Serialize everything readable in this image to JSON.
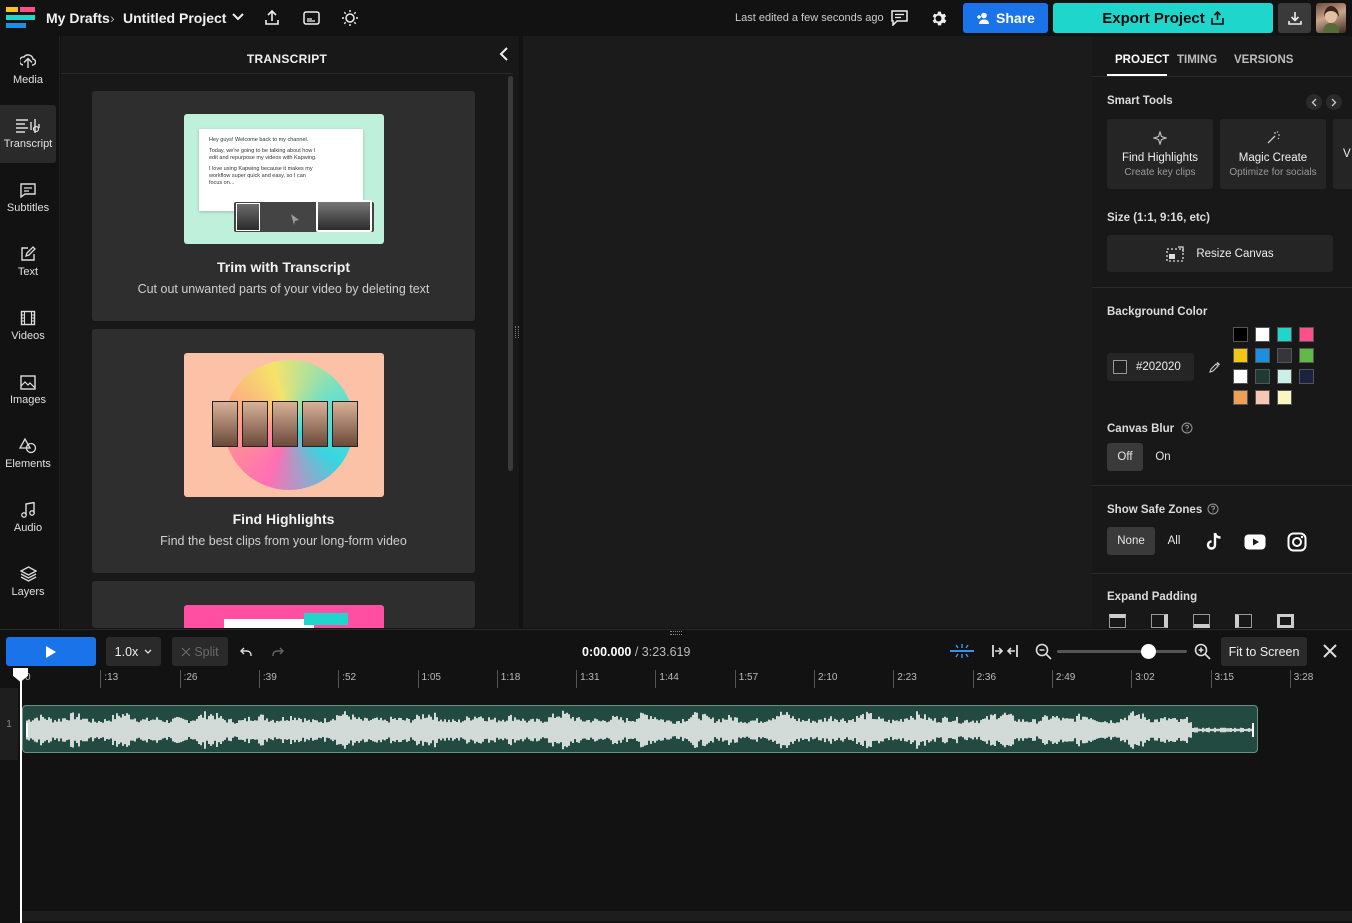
{
  "topbar": {
    "breadcrumb_root": "My Drafts",
    "project_title": "Untitled Project",
    "last_edited": "Last edited a few seconds ago",
    "share_label": "Share",
    "export_label": "Export Project",
    "colors": {
      "share": "#1a73e8",
      "export": "#1ed6cb"
    }
  },
  "sidebar": {
    "items": [
      {
        "label": "Media",
        "icon": "upload-icon"
      },
      {
        "label": "Transcript",
        "icon": "transcript-icon"
      },
      {
        "label": "Subtitles",
        "icon": "subtitles-icon"
      },
      {
        "label": "Text",
        "icon": "text-edit-icon"
      },
      {
        "label": "Videos",
        "icon": "film-icon"
      },
      {
        "label": "Images",
        "icon": "image-icon"
      },
      {
        "label": "Elements",
        "icon": "shapes-icon"
      },
      {
        "label": "Audio",
        "icon": "music-note-icon"
      },
      {
        "label": "Layers",
        "icon": "layers-icon"
      }
    ],
    "active": "Transcript"
  },
  "transcript": {
    "title": "TRANSCRIPT",
    "cards": [
      {
        "title": "Trim with Transcript",
        "description": "Cut out unwanted parts of your video by deleting text",
        "preview_lines": [
          "Hey guys! Welcome back to my channel.",
          "Today, we're going to be talking about how I",
          "edit and repurpose my videos with Kapwing.",
          "I love using Kapwing because it makes my",
          "workflow super quick and easy, so I can",
          "focus on..."
        ]
      },
      {
        "title": "Find Highlights",
        "description": "Find the best clips from your long-form video"
      },
      {
        "title": "",
        "description": ""
      }
    ]
  },
  "right_panel": {
    "tabs": [
      "PROJECT",
      "TIMING",
      "VERSIONS"
    ],
    "active_tab": "PROJECT",
    "smart_tools_label": "Smart Tools",
    "tools": [
      {
        "title": "Find Highlights",
        "subtitle": "Create key clips",
        "icon": "sparkle-icon"
      },
      {
        "title": "Magic Create",
        "subtitle": "Optimize for socials",
        "icon": "magic-wand-icon"
      },
      {
        "title": "V",
        "subtitle": "",
        "icon": ""
      }
    ],
    "size_label": "Size (1:1, 9:16, etc)",
    "resize_label": "Resize Canvas",
    "bg_color_label": "Background Color",
    "bg_color_value": "#202020",
    "swatches": [
      "#000000",
      "#ffffff",
      "#1ed6cb",
      "#ff4f8b",
      "#f5c518",
      "#1a8fe3",
      "#34363c",
      "#5fba46",
      "#ffffff",
      "#1f3a33",
      "#c8f0e6",
      "#1b2240",
      "#f0a055",
      "#f8c7b4",
      "#fbf6c0"
    ],
    "canvas_blur_label": "Canvas Blur",
    "blur_options": [
      "Off",
      "On"
    ],
    "blur_selected": "Off",
    "safe_zones_label": "Show Safe Zones",
    "safe_zone_options": [
      "None",
      "All"
    ],
    "safe_zone_selected": "None",
    "safe_zone_icons": [
      "tiktok-icon",
      "youtube-icon",
      "instagram-icon"
    ],
    "expand_padding_label": "Expand Padding"
  },
  "timeline": {
    "speed": "1.0x",
    "split_label": "Split",
    "current_time": "0:00.000",
    "duration": "/ 3:23.619",
    "fit_label": "Fit to Screen",
    "zoom_level": 0.7,
    "track_number": "1",
    "ticks": [
      "0",
      ":13",
      ":26",
      ":39",
      ":52",
      "1:05",
      "1:18",
      "1:31",
      "1:44",
      "1:57",
      "2:10",
      "2:23",
      "2:36",
      "2:49",
      "3:02",
      "3:15",
      "3:28"
    ]
  }
}
